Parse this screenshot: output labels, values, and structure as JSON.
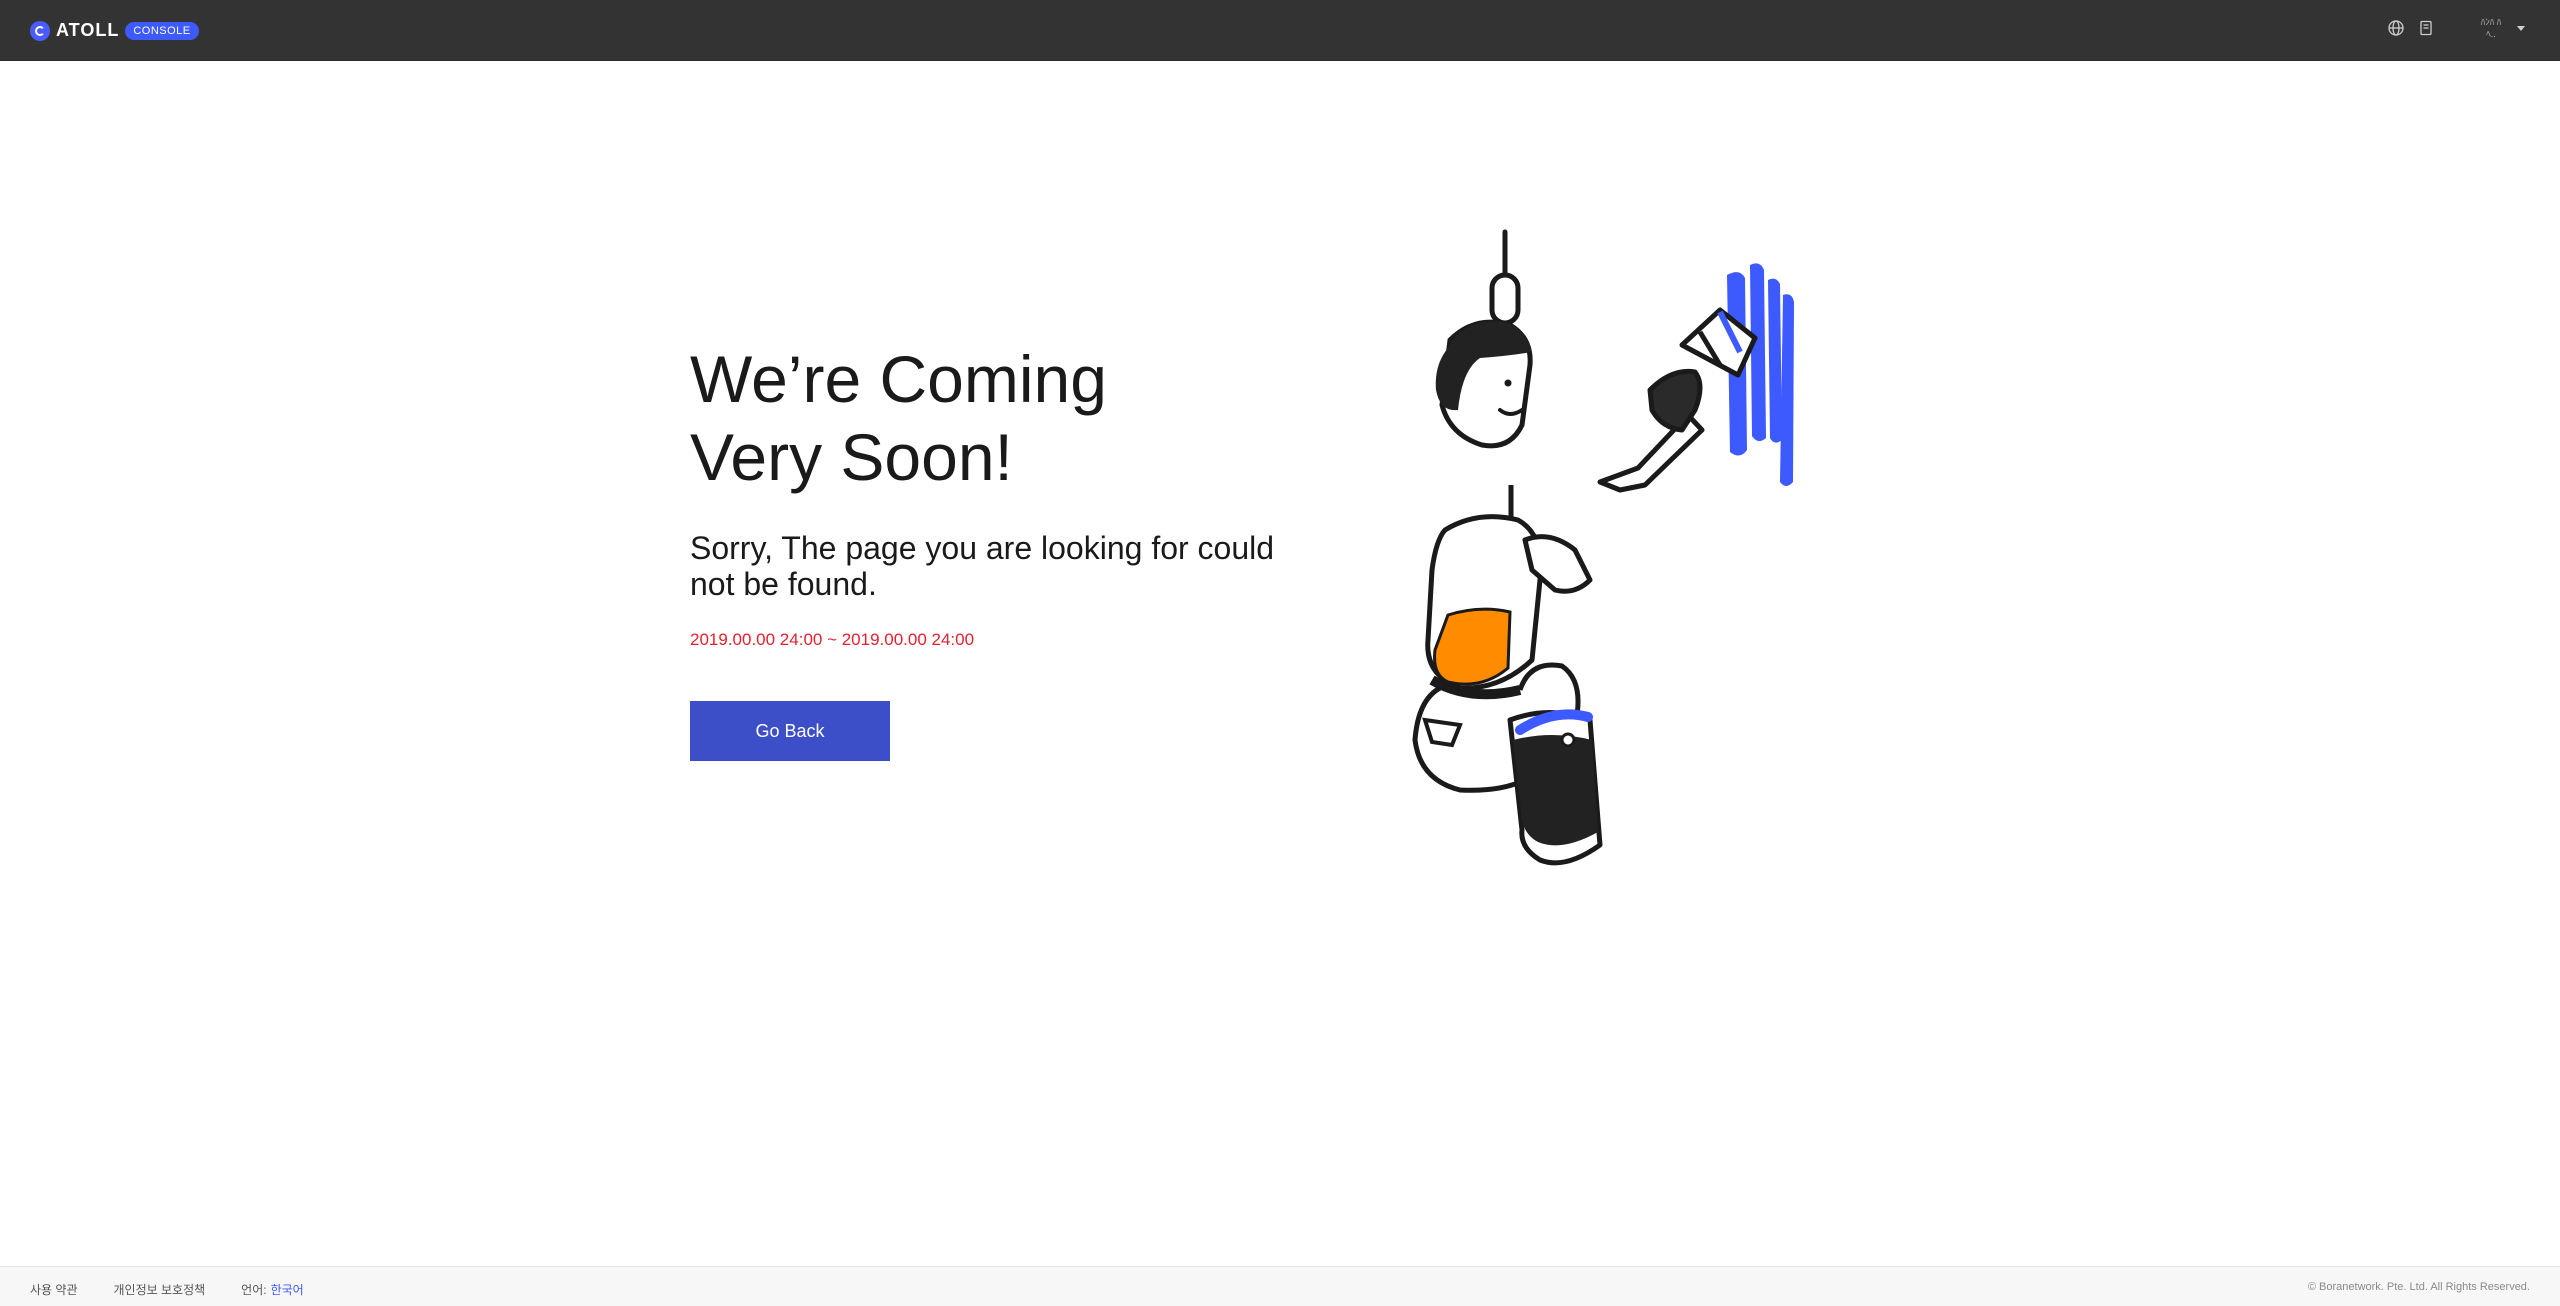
{
  "header": {
    "brand_name": "ATOLL",
    "brand_badge": "CONSOLE",
    "user_line1": "ﾊﾝﾊ ﾊ",
    "user_line2": "ﾍ.."
  },
  "main": {
    "headline_line1": "We’re Coming",
    "headline_line2": "Very Soon!",
    "subtext": "Sorry, The page you are looking for could not be found.",
    "period": "2019.00.00 24:00 ~ 2019.00.00 24:00",
    "go_back_label": "Go Back"
  },
  "footer": {
    "terms_label": "사용 약관",
    "privacy_label": "개인정보 보호정책",
    "language_label": "언어:",
    "language_value": "한국어",
    "copyright": "© Boranetwork. Pte. Ltd. All Rights Reserved."
  },
  "colors": {
    "header_bg": "#333333",
    "brand_accent": "#3d5afe",
    "button_bg": "#3d4fc8",
    "period_text": "#e5202f",
    "paint_blue": "#3d5afe",
    "apron_orange": "#ff8c00"
  },
  "icons": {
    "globe": "globe-icon",
    "docs": "book-icon",
    "caret": "caret-down-icon"
  }
}
